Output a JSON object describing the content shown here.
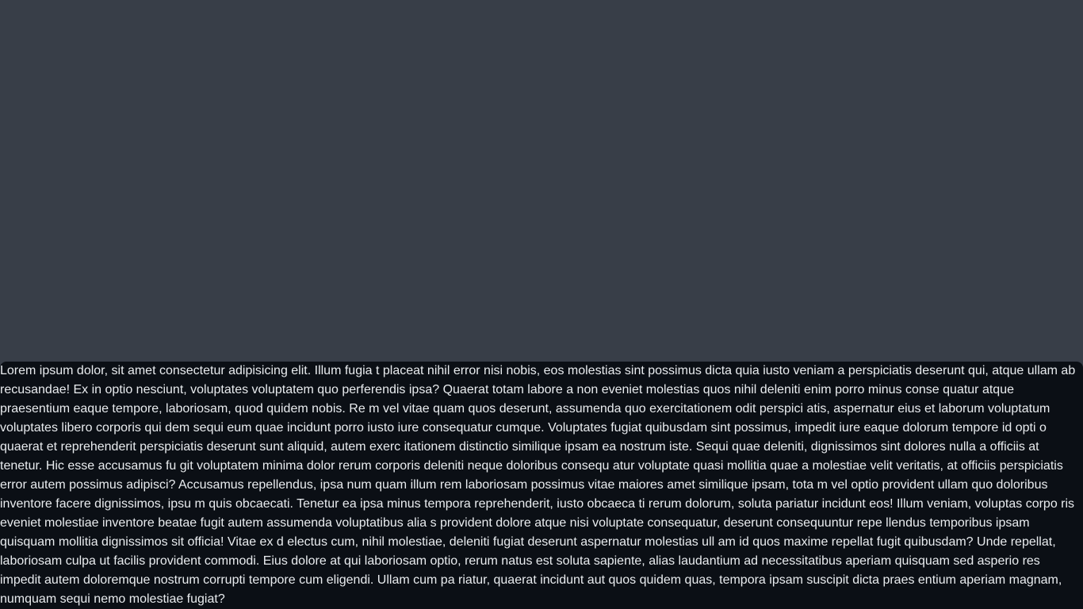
{
  "panel": {
    "text": "Lorem ipsum dolor, sit amet consectetur adipisicing elit. Illum fugia t placeat nihil error nisi nobis, eos molestias sint possimus dicta quia iusto veniam a perspiciatis deserunt qui, atque ullam ab recusandae! Ex in optio nesciunt, voluptates voluptatem quo perferendis ipsa? Quaerat totam labore a non eveniet molestias quos nihil deleniti enim porro minus conse quatur atque praesentium eaque tempore, laboriosam, quod quidem nobis. Re m vel vitae quam quos deserunt, assumenda quo exercitationem odit perspici atis, aspernatur eius et laborum voluptatum voluptates libero corporis qui dem sequi eum quae incidunt porro iusto iure consequatur cumque. Voluptates fugiat quibusdam sint possimus, impedit iure eaque dolorum tempore id opti o quaerat et reprehenderit perspiciatis deserunt sunt aliquid, autem exerc itationem distinctio similique ipsam ea nostrum iste. Sequi quae deleniti, dignissimos sint dolores nulla a officiis at tenetur. Hic esse accusamus fu git voluptatem minima dolor rerum corporis deleniti neque doloribus consequ atur voluptate quasi mollitia quae a molestiae velit veritatis, at officiis perspiciatis error autem possimus adipisci? Accusamus repellendus, ipsa num quam illum rem laboriosam possimus vitae maiores amet similique ipsam, tota m vel optio provident ullam quo doloribus inventore facere dignissimos, ipsu m quis obcaecati. Tenetur ea ipsa minus tempora reprehenderit, iusto obcaeca ti rerum dolorum, soluta pariatur incidunt eos! Illum veniam, voluptas corpo ris eveniet molestiae inventore beatae fugit autem assumenda voluptatibus alia s provident dolore atque nisi voluptate consequatur, deserunt consequuntur repe llendus temporibus ipsam quisquam mollitia dignissimos sit officia! Vitae ex d electus cum, nihil molestiae, deleniti fugiat deserunt aspernatur molestias ull am id quos maxime repellat fugit quibusdam? Unde repellat, laboriosam culpa ut facilis provident commodi. Eius dolore at qui laboriosam optio, rerum natus est soluta sapiente, alias laudantium ad necessitatibus aperiam quisquam sed asperio res impedit autem doloremque nostrum corrupti tempore cum eligendi. Ullam cum pa riatur, quaerat incidunt aut quos quidem quas, tempora ipsam suscipit dicta praes entium aperiam magnam, numquam sequi nemo molestiae fugiat?"
  },
  "colors": {
    "background": "#383e48",
    "panel_background": "#0b0f15",
    "text": "#e9ecef"
  }
}
